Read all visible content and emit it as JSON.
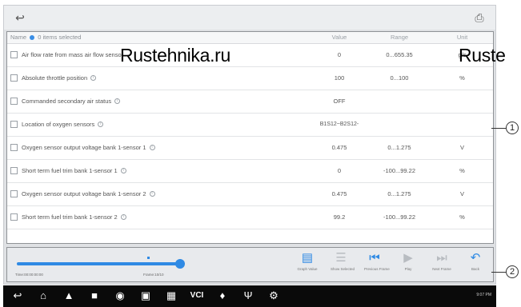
{
  "header": {
    "back_icon": "back-arrow-icon",
    "print_icon": "print-icon"
  },
  "table": {
    "col_name": "Name",
    "selected_text": "0 items selected",
    "col_value": "Value",
    "col_range": "Range",
    "col_unit": "Unit",
    "rows": [
      {
        "name": "Air flow rate from mass air flow sensor",
        "value": "0",
        "range": "0...655.35",
        "unit": "g/s"
      },
      {
        "name": "Absolute throttle position",
        "value": "100",
        "range": "0...100",
        "unit": "%"
      },
      {
        "name": "Commanded secondary air status",
        "value": "OFF",
        "range": "",
        "unit": ""
      },
      {
        "name": "Location of oxygen sensors",
        "value": "B1S12~B2S12-",
        "range": "",
        "unit": ""
      },
      {
        "name": "Oxygen sensor output voltage bank 1-sensor 1",
        "value": "0.475",
        "range": "0...1.275",
        "unit": "V"
      },
      {
        "name": "Short term fuel trim bank 1-sensor 1",
        "value": "0",
        "range": "-100...99.22",
        "unit": "%"
      },
      {
        "name": "Oxygen sensor output voltage bank 1-sensor 2",
        "value": "0.475",
        "range": "0...1.275",
        "unit": "V"
      },
      {
        "name": "Short term fuel trim bank 1-sensor 2",
        "value": "99.2",
        "range": "-100...99.22",
        "unit": "%"
      }
    ]
  },
  "watermark": {
    "left": "Rustehnika.ru",
    "right": "Ruste"
  },
  "playback": {
    "time_left": "Time:00:00:00:00",
    "time_right": "Frame:10/10",
    "progress": 1.0
  },
  "toolbar": [
    {
      "label": "Graph Value",
      "icon": "graph-icon"
    },
    {
      "label": "Show Selected",
      "icon": "list-icon"
    },
    {
      "label": "Previous Frame",
      "icon": "previous-frame-icon"
    },
    {
      "label": "Play",
      "icon": "play-icon"
    },
    {
      "label": "Next Frame",
      "icon": "next-frame-icon"
    },
    {
      "label": "Back",
      "icon": "back-icon"
    }
  ],
  "callouts": {
    "c1": "1",
    "c2": "2"
  },
  "nav": {
    "status_text": "9:07 PM"
  }
}
